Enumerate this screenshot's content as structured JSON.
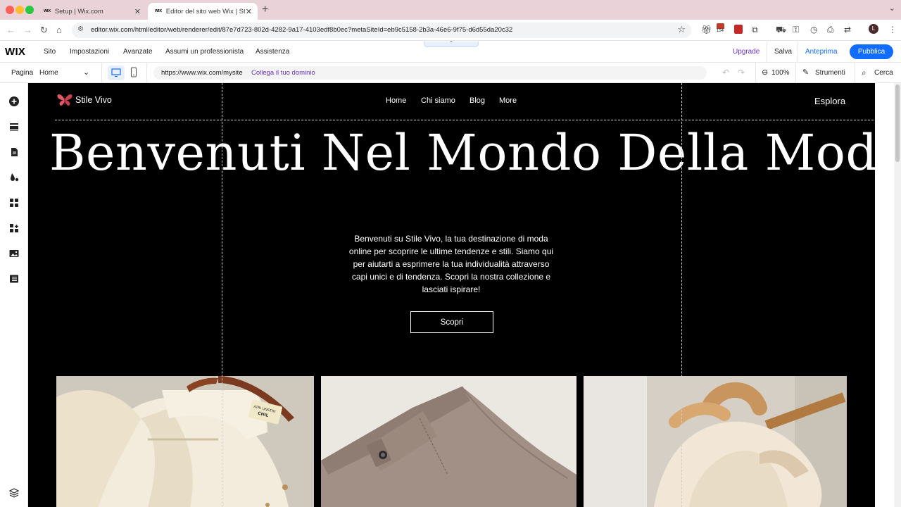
{
  "browser": {
    "tabs": [
      {
        "favicon": "WIX",
        "title": "Setup | Wix.com"
      },
      {
        "favicon": "WIX",
        "title": "Editor del sito web Wix | Stile"
      }
    ],
    "url": "editor.wix.com/html/editor/web/renderer/edit/87e7d723-802d-4282-9a17-4103edf8b0ec?metaSiteId=eb9c5158-2b3a-46e6-9f75-d6d55da20c32",
    "extension_badge": "154",
    "profile_initial": "L"
  },
  "wix_top": {
    "logo": "WIX",
    "menu": [
      "Sito",
      "Impostazioni",
      "Avanzate",
      "Assumi un professionista",
      "Assistenza"
    ],
    "upgrade": "Upgrade",
    "save": "Salva",
    "preview": "Anteprima",
    "publish": "Pubblica"
  },
  "wix_toolbar": {
    "page_label": "Pagina",
    "page_value": "Home",
    "site_url": "https://www.wix.com/mysite",
    "connect_domain": "Collega il tuo dominio",
    "zoom": "100%",
    "tools": "Strumenti",
    "search": "Cerca"
  },
  "site": {
    "brand_name": "Stile Vivo",
    "nav": [
      "Home",
      "Chi siamo",
      "Blog",
      "More"
    ],
    "explore": "Esplora",
    "hero_title": "Benvenuti Nel Mondo Della Moda",
    "hero_text": "Benvenuti su Stile Vivo, la tua destinazione di moda online per scoprire le ultime tendenze e stili. Siamo qui per aiutarti a esprimere la tua individualità attraverso capi unici e di tendenza. Scopri la nostra collezione e lasciati ispirare!",
    "cta": "Scopri",
    "shirt_label": [
      "ATRI UNSTRY",
      "CHIL"
    ]
  },
  "colors": {
    "publish_blue": "#116dff",
    "upgrade_purple": "#6a32c9",
    "canvas_black": "#000000",
    "tabbar_pink": "#ead3d8",
    "butterfly": "#e05a6a"
  }
}
